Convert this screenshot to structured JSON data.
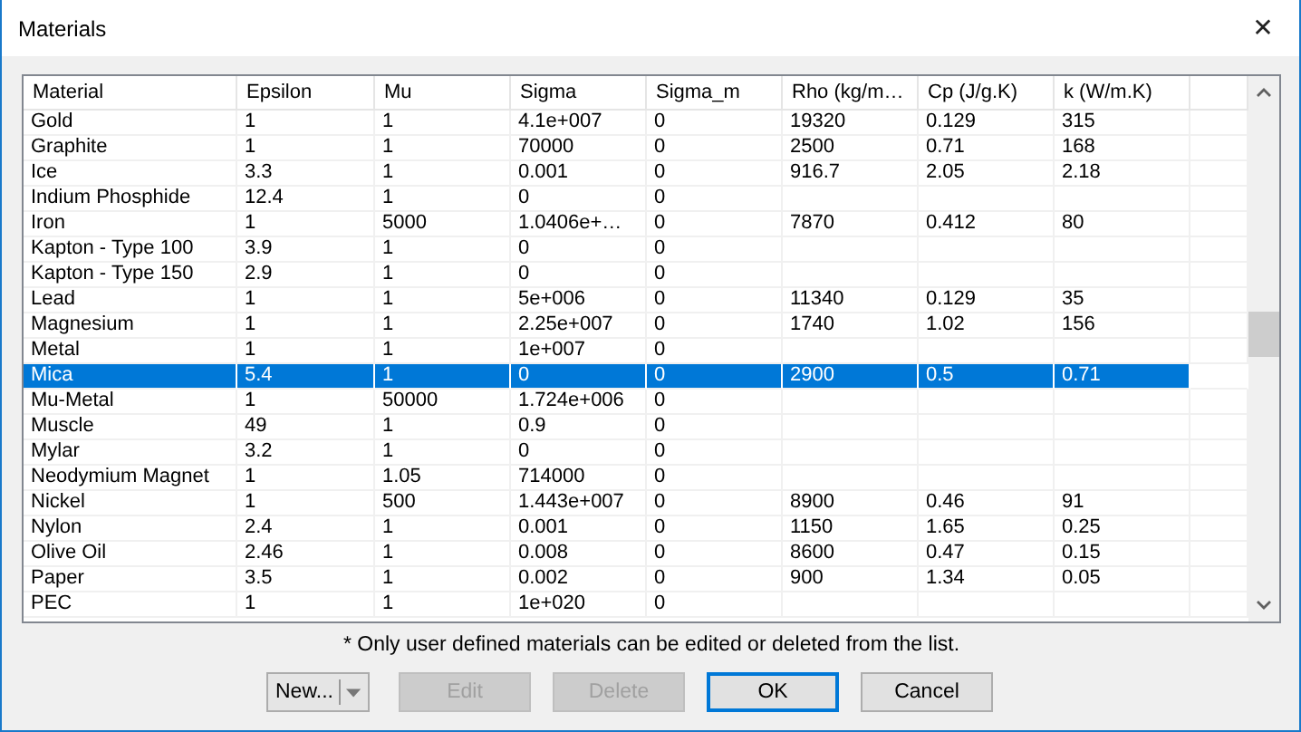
{
  "window": {
    "title": "Materials",
    "close": "✕"
  },
  "table": {
    "columns": [
      "Material",
      "Epsilon",
      "Mu",
      "Sigma",
      "Sigma_m",
      "Rho (kg/m…",
      "Cp (J/g.K)",
      "k (W/m.K)"
    ],
    "rows": [
      {
        "cells": [
          "Gold",
          "1",
          "1",
          "4.1e+007",
          "0",
          "19320",
          "0.129",
          "315"
        ],
        "selected": false
      },
      {
        "cells": [
          "Graphite",
          "1",
          "1",
          "70000",
          "0",
          "2500",
          "0.71",
          "168"
        ],
        "selected": false
      },
      {
        "cells": [
          "Ice",
          "3.3",
          "1",
          "0.001",
          "0",
          "916.7",
          "2.05",
          "2.18"
        ],
        "selected": false
      },
      {
        "cells": [
          "Indium Phosphide",
          "12.4",
          "1",
          "0",
          "0",
          "",
          "",
          ""
        ],
        "selected": false
      },
      {
        "cells": [
          "Iron",
          "1",
          "5000",
          "1.0406e+…",
          "0",
          "7870",
          "0.412",
          "80"
        ],
        "selected": false
      },
      {
        "cells": [
          "Kapton - Type 100",
          "3.9",
          "1",
          "0",
          "0",
          "",
          "",
          ""
        ],
        "selected": false
      },
      {
        "cells": [
          "Kapton - Type 150",
          "2.9",
          "1",
          "0",
          "0",
          "",
          "",
          ""
        ],
        "selected": false
      },
      {
        "cells": [
          "Lead",
          "1",
          "1",
          "5e+006",
          "0",
          "11340",
          "0.129",
          "35"
        ],
        "selected": false
      },
      {
        "cells": [
          "Magnesium",
          "1",
          "1",
          "2.25e+007",
          "0",
          "1740",
          "1.02",
          "156"
        ],
        "selected": false
      },
      {
        "cells": [
          "Metal",
          "1",
          "1",
          "1e+007",
          "0",
          "",
          "",
          ""
        ],
        "selected": false
      },
      {
        "cells": [
          "Mica",
          "5.4",
          "1",
          "0",
          "0",
          "2900",
          "0.5",
          "0.71"
        ],
        "selected": true
      },
      {
        "cells": [
          "Mu-Metal",
          "1",
          "50000",
          "1.724e+006",
          "0",
          "",
          "",
          ""
        ],
        "selected": false
      },
      {
        "cells": [
          "Muscle",
          "49",
          "1",
          "0.9",
          "0",
          "",
          "",
          ""
        ],
        "selected": false
      },
      {
        "cells": [
          "Mylar",
          "3.2",
          "1",
          "0",
          "0",
          "",
          "",
          ""
        ],
        "selected": false
      },
      {
        "cells": [
          "Neodymium Magnet",
          "1",
          "1.05",
          "714000",
          "0",
          "",
          "",
          ""
        ],
        "selected": false
      },
      {
        "cells": [
          "Nickel",
          "1",
          "500",
          "1.443e+007",
          "0",
          "8900",
          "0.46",
          "91"
        ],
        "selected": false
      },
      {
        "cells": [
          "Nylon",
          "2.4",
          "1",
          "0.001",
          "0",
          "1150",
          "1.65",
          "0.25"
        ],
        "selected": false
      },
      {
        "cells": [
          "Olive Oil",
          "2.46",
          "1",
          "0.008",
          "0",
          "8600",
          "0.47",
          "0.15"
        ],
        "selected": false
      },
      {
        "cells": [
          "Paper",
          "3.5",
          "1",
          "0.002",
          "0",
          "900",
          "1.34",
          "0.05"
        ],
        "selected": false
      },
      {
        "cells": [
          "PEC",
          "1",
          "1",
          "1e+020",
          "0",
          "",
          "",
          ""
        ],
        "selected": false
      }
    ]
  },
  "note": "* Only user defined materials can be edited or deleted from the list.",
  "buttons": [
    {
      "label": "New...",
      "kind": "split",
      "disabled": false
    },
    {
      "label": "Edit",
      "kind": "push",
      "disabled": true
    },
    {
      "label": "Delete",
      "kind": "push",
      "disabled": true
    },
    {
      "label": "OK",
      "kind": "default",
      "disabled": false
    },
    {
      "label": "Cancel",
      "kind": "push",
      "disabled": false
    }
  ]
}
